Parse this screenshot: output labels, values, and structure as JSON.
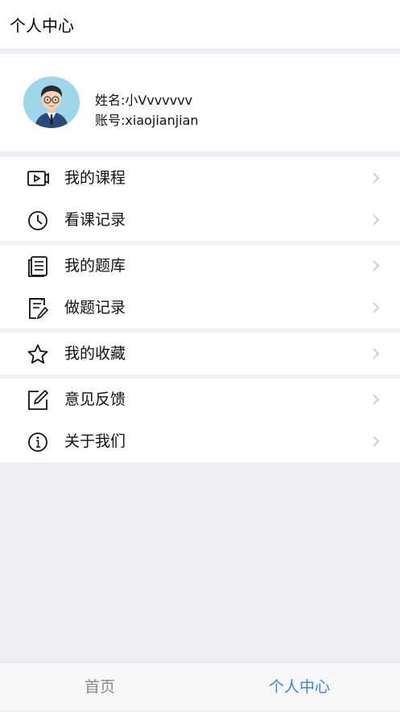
{
  "header": {
    "title": "个人中心"
  },
  "profile": {
    "name_line": "姓名:小Vvvvvvv",
    "account_line": "账号:xiaojianjian"
  },
  "menu": {
    "my_courses": "我的课程",
    "watch_history": "看课记录",
    "my_question_bank": "我的题库",
    "practice_history": "做题记录",
    "my_favorites": "我的收藏",
    "feedback": "意见反馈",
    "about_us": "关于我们"
  },
  "tabbar": {
    "home": "首页",
    "profile": "个人中心",
    "active_color": "#3b7fe0",
    "inactive_color": "#888888"
  }
}
